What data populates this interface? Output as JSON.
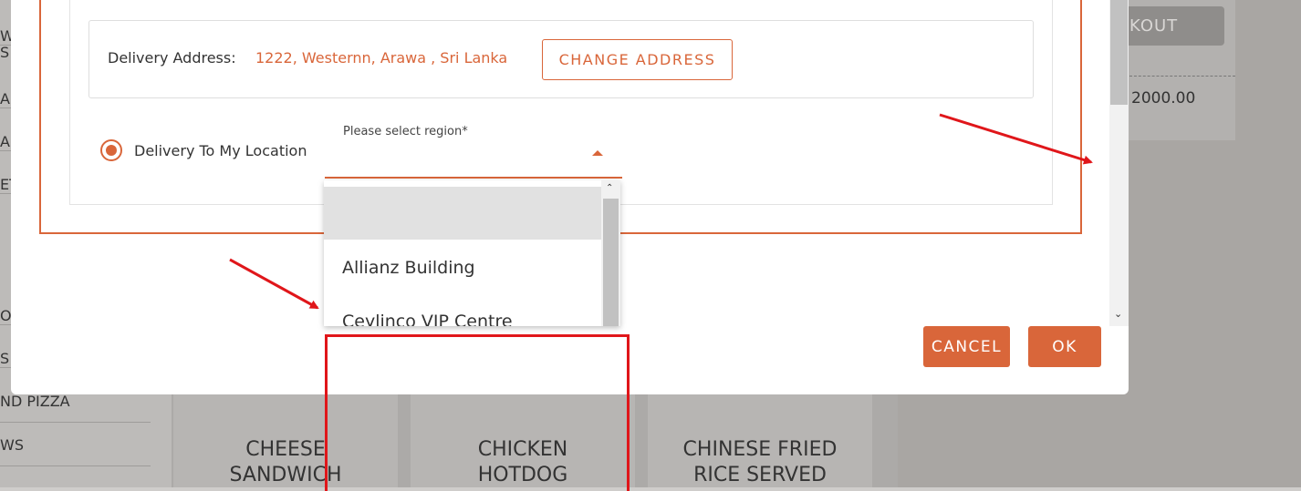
{
  "background": {
    "sidebar_items": [
      "WI",
      "S",
      "A",
      "A",
      "ET",
      "O",
      "S A",
      "ND PIZZA",
      "WS"
    ],
    "checkout_label": "KOUT",
    "total_value": "2000.00",
    "cards": [
      {
        "line1": "CHEESE",
        "line2": "SANDWICH"
      },
      {
        "line1": "CHICKEN",
        "line2": "HOTDOG"
      },
      {
        "line1": "CHINESE FRIED",
        "line2": "RICE SERVED"
      }
    ]
  },
  "modal": {
    "address": {
      "label": "Delivery Address:",
      "value": "1222, Westernn, Arawa , Sri Lanka",
      "change_button": "CHANGE ADDRESS"
    },
    "delivery_option": {
      "label": "Delivery To My Location",
      "selected": true
    },
    "region": {
      "label": "Please select region*",
      "selected_value": "",
      "options": [
        "",
        "Allianz Building",
        "Ceylinco VIP Centre"
      ]
    },
    "buttons": {
      "cancel": "CANCEL",
      "ok": "OK"
    }
  },
  "colors": {
    "accent": "#d9663a",
    "annotation": "#e0161a"
  }
}
